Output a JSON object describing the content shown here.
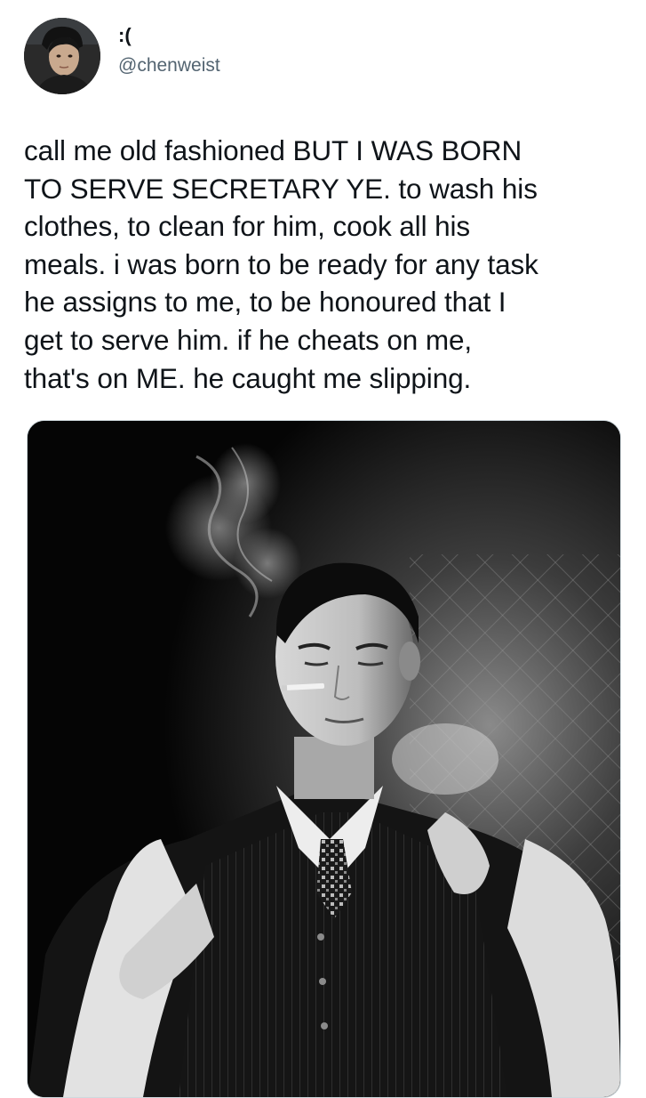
{
  "tweet": {
    "author": {
      "display_name": ":(",
      "handle": "@chenweist",
      "avatar_icon": "profile-photo"
    },
    "text": "call me old fashioned BUT I WAS BORN\nTO SERVE SECRETARY YE. to wash his\nclothes, to clean for him, cook all his\nmeals. i was born to be ready for any task\nhe assigns to me, to be honoured that I\nget to serve him. if he cheats on me,\nthat's on ME. he caught me slipping.",
    "media": {
      "type": "photo",
      "style": "black-and-white"
    }
  },
  "colors": {
    "text_primary": "#0f1419",
    "text_secondary": "#536471",
    "border": "#cfd9de",
    "background": "#ffffff"
  }
}
